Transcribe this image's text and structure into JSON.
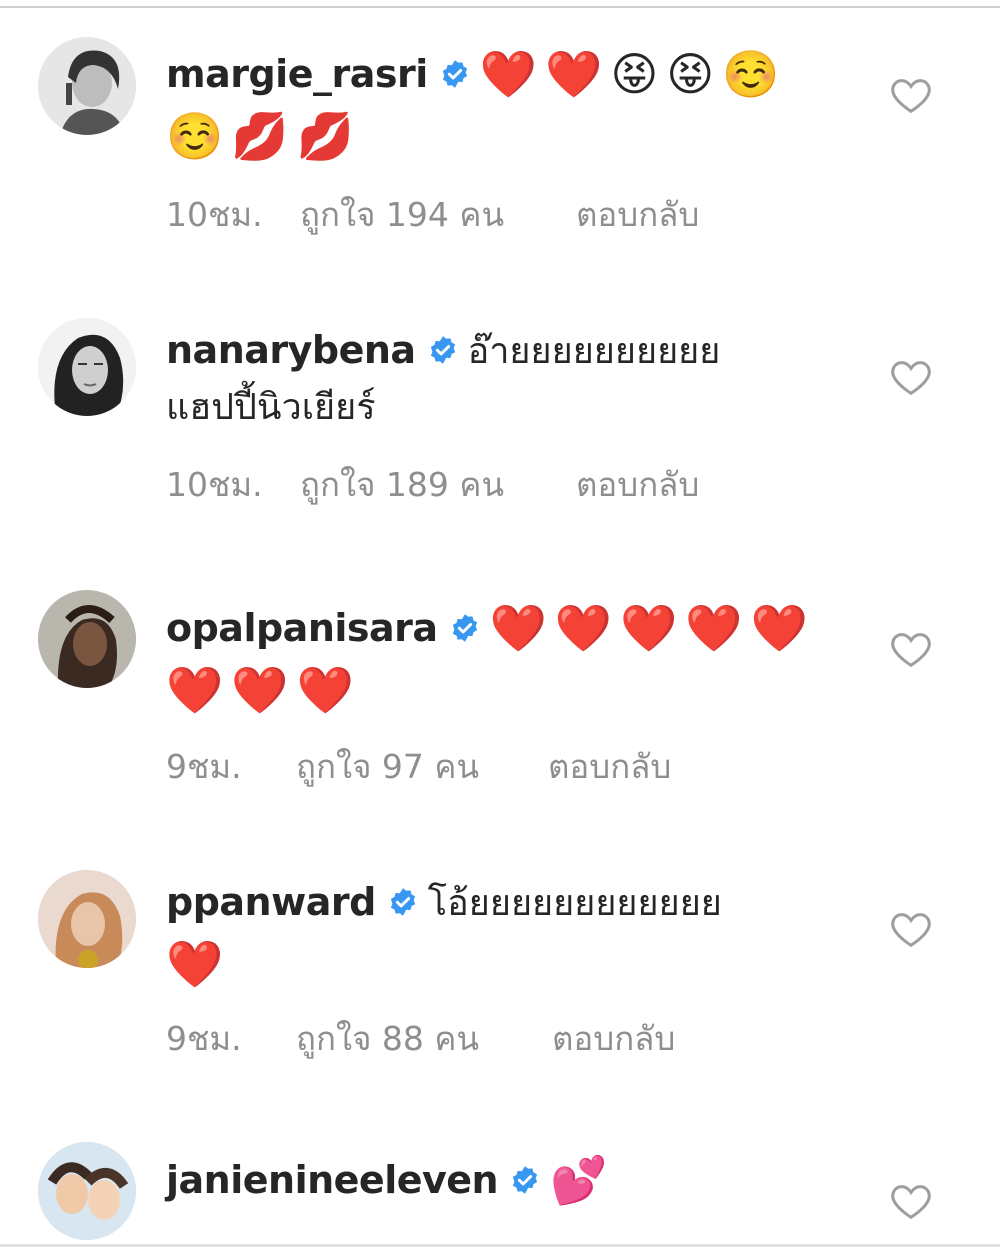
{
  "colors": {
    "verified": "#3897f0",
    "meta_text": "#8e8e8e",
    "heart_outline": "#9e9e9e"
  },
  "comments": [
    {
      "username": "margie_rasri",
      "text": "",
      "line1_emoji": [
        "❤️",
        "❤️",
        "😝",
        "😝",
        "☺️"
      ],
      "line2_text": "",
      "line2_emoji": [
        "☺️",
        "💋",
        "💋"
      ],
      "time": "10ชม.",
      "likes": "ถูกใจ 194 คน",
      "reply": "ตอบกลับ"
    },
    {
      "username": "nanarybena",
      "text": "อ๊ายยยยยยยยยย",
      "line1_emoji": [],
      "line2_text": "แฮปปี้นิวเยียร์",
      "line2_emoji": [],
      "time": "10ชม.",
      "likes": "ถูกใจ 189 คน",
      "reply": "ตอบกลับ"
    },
    {
      "username": "opalpanisara",
      "text": "",
      "line1_emoji": [
        "❤️",
        "❤️",
        "❤️",
        "❤️",
        "❤️"
      ],
      "line2_text": "",
      "line2_emoji": [
        "❤️",
        "❤️",
        "❤️"
      ],
      "time": "9ชม.",
      "likes": "ถูกใจ 97 คน",
      "reply": "ตอบกลับ"
    },
    {
      "username": "ppanward",
      "text": "โอ้ยยยยยยยยยยยย",
      "line1_emoji": [],
      "line2_text": "",
      "line2_emoji": [
        "❤️"
      ],
      "time": "9ชม.",
      "likes": "ถูกใจ 88 คน",
      "reply": "ตอบกลับ"
    },
    {
      "username": "janienineeleven",
      "text": "",
      "line1_emoji": [
        "💕"
      ],
      "line2_text": "",
      "line2_emoji": [],
      "time": "",
      "likes": "",
      "reply": ""
    }
  ]
}
